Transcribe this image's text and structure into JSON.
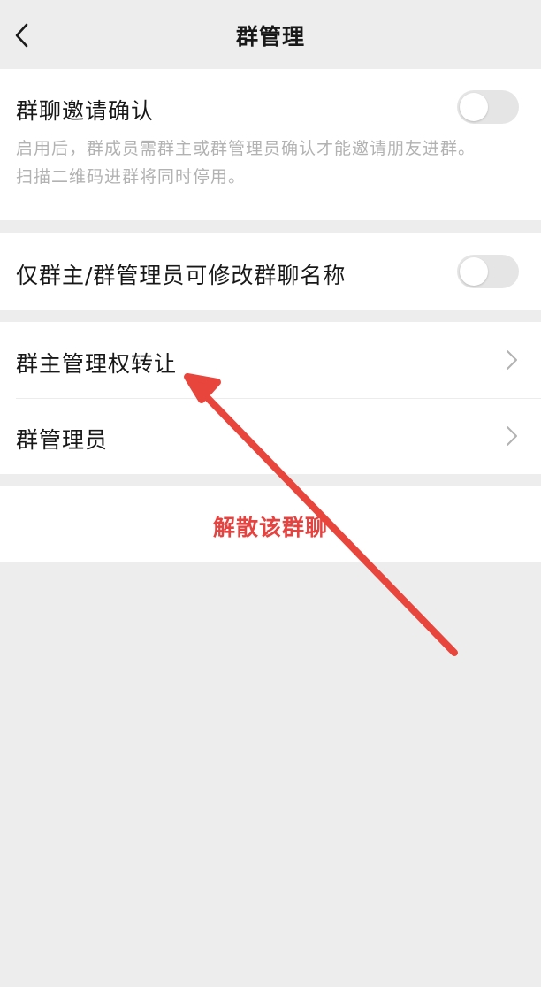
{
  "header": {
    "title": "群管理",
    "back_icon": "chevron-left-icon"
  },
  "invite_confirm": {
    "label": "群聊邀请确认",
    "description_line1": "启用后，群成员需群主或群管理员确认才能邀请朋友进群。",
    "description_line2": "扫描二维码进群将同时停用。",
    "enabled": false
  },
  "rename_restrict": {
    "label": "仅群主/群管理员可修改群聊名称",
    "enabled": false
  },
  "menu": {
    "transfer_owner_label": "群主管理权转让",
    "admins_label": "群管理员",
    "chevron_icon": "chevron-right-icon"
  },
  "danger": {
    "dissolve_label": "解散该群聊"
  },
  "colors": {
    "background": "#ededed",
    "card": "#ffffff",
    "danger": "#e64340",
    "annotation_arrow": "#e8453c",
    "toggle_off": "#e5e5e5"
  }
}
